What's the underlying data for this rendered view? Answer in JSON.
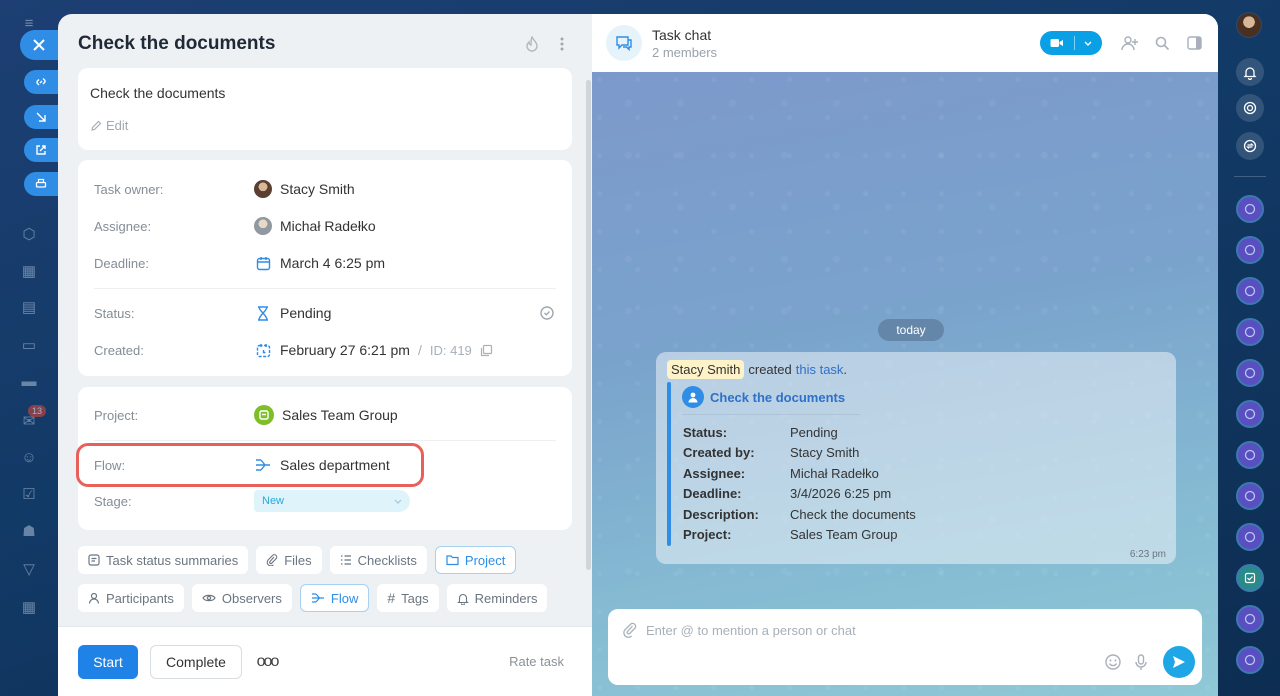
{
  "task": {
    "title": "Check the documents",
    "description": "Check the documents",
    "edit_label": "Edit",
    "fields": {
      "owner_label": "Task owner:",
      "owner_value": "Stacy Smith",
      "assignee_label": "Assignee:",
      "assignee_value": "Michał Radełko",
      "deadline_label": "Deadline:",
      "deadline_value": "March 4 6:25 pm",
      "status_label": "Status:",
      "status_value": "Pending",
      "created_label": "Created:",
      "created_value": "February 27 6:21 pm",
      "id_sep": "/",
      "id_value": "ID: 419",
      "project_label": "Project:",
      "project_value": "Sales Team Group",
      "flow_label": "Flow:",
      "flow_value": "Sales department",
      "stage_label": "Stage:",
      "stage_value": "New"
    },
    "chips_row1": [
      "Task status summaries",
      "Files",
      "Checklists",
      "Project"
    ],
    "chips_row2": [
      "Participants",
      "Observers",
      "Flow",
      "Tags",
      "Reminders"
    ],
    "footer": {
      "start": "Start",
      "complete": "Complete",
      "more": "ooo",
      "rate": "Rate task"
    }
  },
  "chat": {
    "title": "Task chat",
    "subtitle": "2 members",
    "today": "today",
    "message": {
      "author": "Stacy Smith",
      "action": "created",
      "link": "this task",
      "period": ".",
      "quote_title": "Check the documents",
      "rows": [
        {
          "k": "Status:",
          "v": "Pending"
        },
        {
          "k": "Created by:",
          "v": "Stacy Smith"
        },
        {
          "k": "Assignee:",
          "v": "Michał Radełko"
        },
        {
          "k": "Deadline:",
          "v": "3/4/2026 6:25 pm"
        },
        {
          "k": "Description:",
          "v": "Check the documents"
        },
        {
          "k": "Project:",
          "v": "Sales Team Group"
        }
      ],
      "time": "6:23 pm"
    },
    "input_placeholder": "Enter @ to mention a person or chat"
  },
  "left_badge": "13",
  "colors": {
    "accent": "#2f8de6",
    "highlight": "#e8605a",
    "video": "#0aa0e6"
  }
}
